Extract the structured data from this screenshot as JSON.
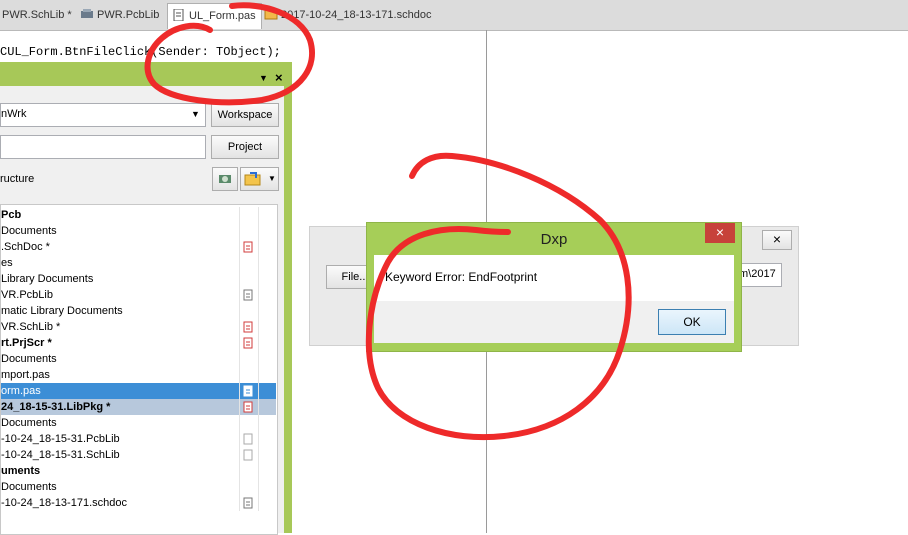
{
  "tabs": [
    {
      "label": "PWR.SchLib *"
    },
    {
      "label": "PWR.PcbLib"
    },
    {
      "label": "UL_Form.pas"
    },
    {
      "label": "2017-10-24_18-13-171.schdoc"
    }
  ],
  "code": {
    "line": "CUL_Form.BtnFileClick(Sender: TObject);"
  },
  "panel": {
    "workspace_value": "nWrk",
    "workspace_button": "Workspace",
    "project_value": "",
    "project_button": "Project",
    "structure_label": "ructure",
    "tree": [
      {
        "text": "Pcb",
        "bold": true,
        "state": ""
      },
      {
        "text": " Documents",
        "bold": false,
        "state": ""
      },
      {
        "text": ".SchDoc *",
        "bold": false,
        "state": "",
        "icon": "red-doc-icon"
      },
      {
        "text": "es",
        "bold": false,
        "state": ""
      },
      {
        "text": " Library Documents",
        "bold": false,
        "state": ""
      },
      {
        "text": "VR.PcbLib",
        "bold": false,
        "state": "",
        "icon": "gray-doc-icon"
      },
      {
        "text": "matic Library Documents",
        "bold": false,
        "state": ""
      },
      {
        "text": "VR.SchLib *",
        "bold": false,
        "state": "",
        "icon": "red-doc-icon"
      },
      {
        "text": "rt.PrjScr *",
        "bold": true,
        "state": "",
        "icon": "red-doc-icon"
      },
      {
        "text": " Documents",
        "bold": false,
        "state": ""
      },
      {
        "text": "mport.pas",
        "bold": false,
        "state": ""
      },
      {
        "text": "orm.pas",
        "bold": false,
        "state": "selected",
        "icon": "white-doc-icon"
      },
      {
        "text": "24_18-15-31.LibPkg *",
        "bold": true,
        "state": "secondary",
        "icon": "red-doc-icon"
      },
      {
        "text": " Documents",
        "bold": false,
        "state": ""
      },
      {
        "text": "-10-24_18-15-31.PcbLib",
        "bold": false,
        "state": "",
        "icon": "outline-doc-icon"
      },
      {
        "text": "-10-24_18-15-31.SchLib",
        "bold": false,
        "state": "",
        "icon": "outline-doc-icon"
      },
      {
        "text": "uments",
        "bold": true,
        "state": ""
      },
      {
        "text": " Documents",
        "bold": false,
        "state": ""
      },
      {
        "text": "-10-24_18-13-171.schdoc",
        "bold": false,
        "state": "",
        "icon": "gray-doc-icon"
      }
    ]
  },
  "bg_dialog": {
    "file_button": "File...",
    "path_value": "m\\2017"
  },
  "dialog": {
    "title": "Dxp",
    "message": "Keyword Error: EndFootprint",
    "ok_button": "OK",
    "close_symbol": "×"
  },
  "colors": {
    "accent_green": "#a7c858",
    "annotation_red": "#ee2a2a",
    "selection_blue": "#3c8ed6"
  }
}
